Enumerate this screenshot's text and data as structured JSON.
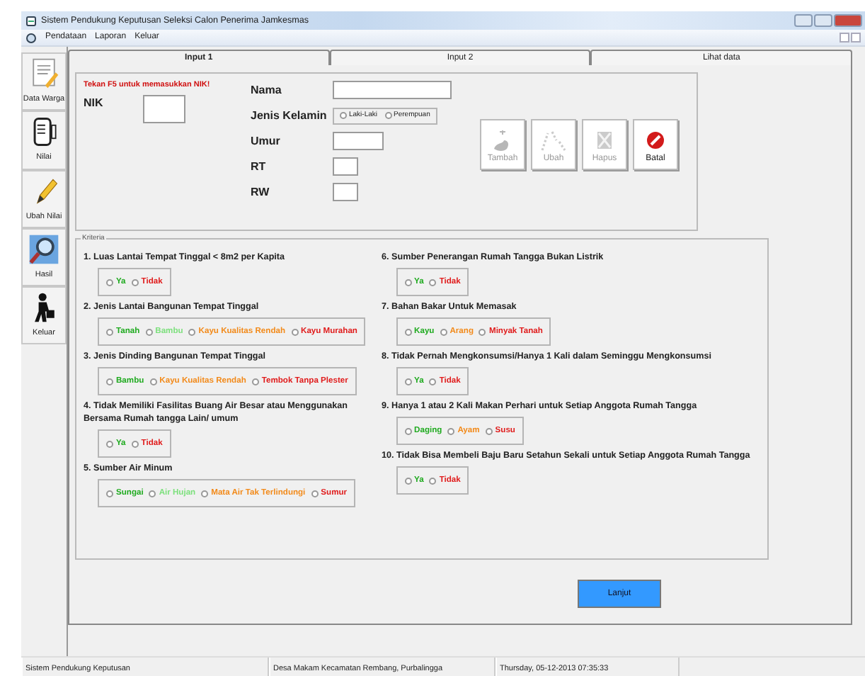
{
  "window": {
    "title": "Sistem Pendukung Keputusan Seleksi Calon Penerima Jamkesmas"
  },
  "menu": [
    "Pendataan",
    "Laporan",
    "Keluar"
  ],
  "sidebar": {
    "items": [
      {
        "label": "Data Warga"
      },
      {
        "label": "Nilai"
      },
      {
        "label": "Ubah Nilai"
      },
      {
        "label": "Hasil"
      },
      {
        "label": "Keluar"
      }
    ]
  },
  "tabs": [
    {
      "label": "Input 1",
      "selected": true
    },
    {
      "label": "Input 2",
      "selected": false
    },
    {
      "label": "Lihat data",
      "selected": false
    }
  ],
  "form": {
    "hint": "Tekan F5 untuk memasukkan NIK!",
    "nik_label": "NIK",
    "fields": [
      {
        "label": "Nama",
        "kind": "text"
      },
      {
        "label": "Jenis Kelamin",
        "kind": "radio",
        "options": [
          {
            "label": "Laki-Laki",
            "checked": false
          },
          {
            "label": "Perempuan",
            "checked": false
          }
        ]
      },
      {
        "label": "Umur",
        "kind": "short"
      },
      {
        "label": "RT",
        "kind": "tiny"
      },
      {
        "label": "RW",
        "kind": "tiny"
      }
    ]
  },
  "actions": [
    {
      "label": "Tambah",
      "disabled": true
    },
    {
      "label": "Ubah",
      "disabled": true
    },
    {
      "label": "Hapus",
      "disabled": true
    },
    {
      "label": "Batal",
      "disabled": false
    }
  ],
  "criteria": {
    "title": "Kriteria",
    "columns": [
      [
        {
          "question": "1. Luas Lantai Tempat Tinggal < 8m2 per Kapita",
          "options": [
            {
              "label": "Ya",
              "color": "#1faa1f",
              "checked": false
            },
            {
              "label": "Tidak",
              "color": "#e01b1b",
              "checked": false
            }
          ]
        },
        {
          "question": "2. Jenis Lantai Bangunan Tempat Tinggal",
          "options": [
            {
              "label": "Tanah",
              "color": "#1faa1f",
              "checked": false
            },
            {
              "label": "Bambu",
              "color": "#7de07d",
              "checked": false
            },
            {
              "label": "Kayu Kualitas Rendah",
              "color": "#f28a1a",
              "checked": false
            },
            {
              "label": "Kayu Murahan",
              "color": "#e01b1b",
              "checked": false
            }
          ]
        },
        {
          "question": "3. Jenis Dinding Bangunan Tempat Tinggal",
          "options": [
            {
              "label": "Bambu",
              "color": "#1faa1f",
              "checked": false
            },
            {
              "label": "Kayu Kualitas Rendah",
              "color": "#f28a1a",
              "checked": false
            },
            {
              "label": "Tembok Tanpa Plester",
              "color": "#e01b1b",
              "checked": false
            }
          ]
        },
        {
          "question": "4. Tidak Memiliki Fasilitas Buang Air Besar atau Menggunakan Bersama Rumah tangga Lain/ umum",
          "options": [
            {
              "label": "Ya",
              "color": "#1faa1f",
              "checked": false
            },
            {
              "label": "Tidak",
              "color": "#e01b1b",
              "checked": false
            }
          ]
        },
        {
          "question": "5. Sumber Air Minum",
          "options": [
            {
              "label": "Sungai",
              "color": "#1faa1f",
              "checked": false
            },
            {
              "label": "Air Hujan",
              "color": "#7de07d",
              "checked": false
            },
            {
              "label": "Mata Air Tak Terlindungi",
              "color": "#f28a1a",
              "checked": false
            },
            {
              "label": "Sumur",
              "color": "#e01b1b",
              "checked": false
            }
          ]
        }
      ],
      [
        {
          "question": "6. Sumber Penerangan Rumah Tangga Bukan Listrik",
          "options": [
            {
              "label": "Ya",
              "color": "#1faa1f",
              "checked": false
            },
            {
              "label": "Tidak",
              "color": "#e01b1b",
              "checked": false
            }
          ]
        },
        {
          "question": "7. Bahan Bakar Untuk Memasak",
          "options": [
            {
              "label": "Kayu",
              "color": "#1faa1f",
              "checked": false
            },
            {
              "label": "Arang",
              "color": "#f28a1a",
              "checked": false
            },
            {
              "label": "Minyak Tanah",
              "color": "#e01b1b",
              "checked": false
            }
          ]
        },
        {
          "question": "8. Tidak Pernah Mengkonsumsi/Hanya 1 Kali dalam Seminggu Mengkonsumsi",
          "options": [
            {
              "label": "Ya",
              "color": "#1faa1f",
              "checked": false
            },
            {
              "label": "Tidak",
              "color": "#e01b1b",
              "checked": false
            }
          ]
        },
        {
          "question": "9. Hanya 1 atau 2 Kali Makan Perhari untuk Setiap Anggota Rumah Tangga",
          "options": [
            {
              "label": "Daging",
              "color": "#1faa1f",
              "checked": false
            },
            {
              "label": "Ayam",
              "color": "#f28a1a",
              "checked": false
            },
            {
              "label": "Susu",
              "color": "#e01b1b",
              "checked": false
            }
          ]
        },
        {
          "question": "10. Tidak Bisa Membeli Baju Baru Setahun Sekali untuk Setiap Anggota Rumah Tangga",
          "options": [
            {
              "label": "Ya",
              "color": "#1faa1f",
              "checked": false
            },
            {
              "label": "Tidak",
              "color": "#e01b1b",
              "checked": false
            }
          ]
        }
      ]
    ]
  },
  "next_button": "Lanjut",
  "status_bar": [
    "Sistem Pendukung Keputusan",
    "Desa Makam Kecamatan Rembang, Purbalingga",
    "Thursday, 05-12-2013 07:35:33"
  ]
}
